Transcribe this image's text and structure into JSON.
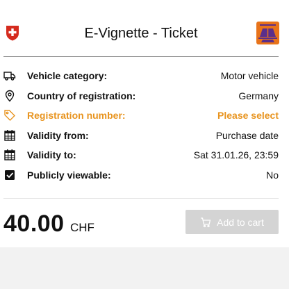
{
  "header": {
    "title": "E-Vignette - Ticket"
  },
  "rows": [
    {
      "icon": "truck-icon",
      "label": "Vehicle category:",
      "value": "Motor vehicle"
    },
    {
      "icon": "location-pin-icon",
      "label": "Country of registration:",
      "value": "Germany"
    },
    {
      "icon": "tag-icon",
      "label": "Registration number:",
      "value": "Please select",
      "highlight": true
    },
    {
      "icon": "calendar-icon",
      "label": "Validity from:",
      "value": "Purchase date"
    },
    {
      "icon": "calendar-icon",
      "label": "Validity to:",
      "value": "Sat 31.01.26, 23:59"
    },
    {
      "icon": "checkbox-checked-icon",
      "label": "Publicly viewable:",
      "value": "No"
    }
  ],
  "price": {
    "amount": "40.00",
    "currency": "CHF"
  },
  "cart": {
    "label": "Add to cart",
    "icon": "cart-icon",
    "state": "disabled"
  },
  "colors": {
    "accent": "#e8941f",
    "badge": "#e8731a",
    "swiss_red": "#d52b1e",
    "disabled_button": "#d4d4d4"
  }
}
